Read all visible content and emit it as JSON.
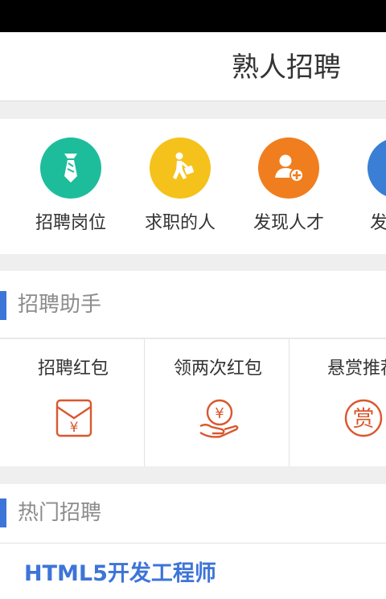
{
  "header": {
    "title": "熟人招聘"
  },
  "quick_nav": {
    "items": [
      {
        "label": "招聘岗位",
        "icon": "tie-icon",
        "color": "#1dbd9b"
      },
      {
        "label": "求职的人",
        "icon": "walking-person-icon",
        "color": "#f5c21c"
      },
      {
        "label": "发现人才",
        "icon": "user-add-icon",
        "color": "#f07e1e"
      },
      {
        "label": "发",
        "icon": "partial-icon",
        "color": "#3a7fd5"
      }
    ]
  },
  "assistant": {
    "title": "招聘助手",
    "items": [
      {
        "label": "招聘红包",
        "icon": "red-envelope-icon"
      },
      {
        "label": "领两次红包",
        "icon": "hand-coin-icon"
      },
      {
        "label": "悬赏推荐",
        "icon": "reward-icon",
        "glyph": "赏"
      }
    ]
  },
  "hot_jobs": {
    "title": "热门招聘",
    "items": [
      {
        "title": "HTML5开发工程师"
      }
    ]
  },
  "colors": {
    "accent": "#3d74d8",
    "icon_red": "#d9572e"
  }
}
